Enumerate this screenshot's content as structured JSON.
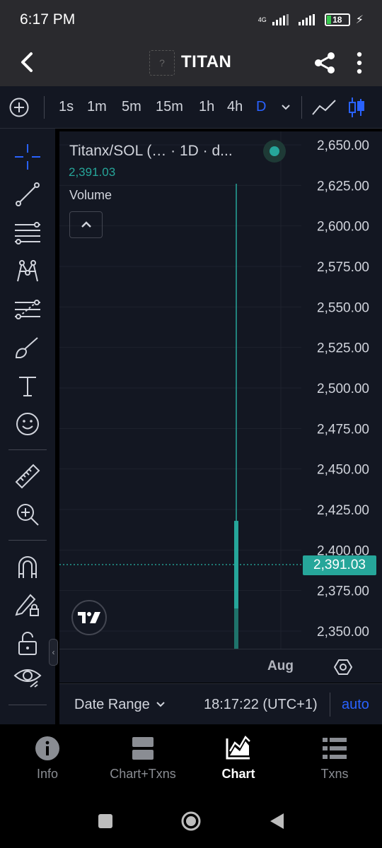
{
  "status_bar": {
    "time": "6:17 PM",
    "network": "4G",
    "battery": "18"
  },
  "header": {
    "logo_placeholder": "?",
    "title": "TITAN"
  },
  "toolbar": {
    "timeframes": [
      "1s",
      "1m",
      "5m",
      "15m",
      "1h",
      "4h",
      "D"
    ],
    "active_timeframe": "D"
  },
  "legend": {
    "title": "Titanx/SOL (… · 1D · d...",
    "price": "2,391.03",
    "volume_label": "Volume"
  },
  "chart_data": {
    "type": "candlestick",
    "symbol_label": "Titanx/SOL (… · 1D · d...",
    "y_tick_labels": [
      "2,650.00",
      "2,625.00",
      "2,600.00",
      "2,575.00",
      "2,550.00",
      "2,525.00",
      "2,500.00",
      "2,475.00",
      "2,450.00",
      "2,425.00",
      "2,400.00",
      "2,375.00",
      "2,350.00"
    ],
    "ylim": [
      2340,
      2660
    ],
    "x_tick_labels": [
      "Aug"
    ],
    "last_price": 2391.03,
    "last_price_label": "2,391.03",
    "candles": [
      {
        "open": 2338,
        "high": 2626,
        "low": 2338,
        "close": 2418,
        "color": "#26a69a"
      }
    ],
    "grid": true,
    "colors": {
      "up": "#26a69a",
      "grid": "#1e222d",
      "background": "#131722"
    }
  },
  "time_axis": {
    "label": "Aug"
  },
  "range_bar": {
    "date_range_label": "Date Range",
    "clock": "18:17:22 (UTC+1)",
    "auto_label": "auto"
  },
  "bottom_nav": {
    "items": [
      {
        "label": "Info",
        "icon": "info-icon"
      },
      {
        "label": "Chart+Txns",
        "icon": "split-view-icon"
      },
      {
        "label": "Chart",
        "icon": "area-chart-icon"
      },
      {
        "label": "Txns",
        "icon": "list-icon"
      }
    ],
    "active": "Chart"
  }
}
